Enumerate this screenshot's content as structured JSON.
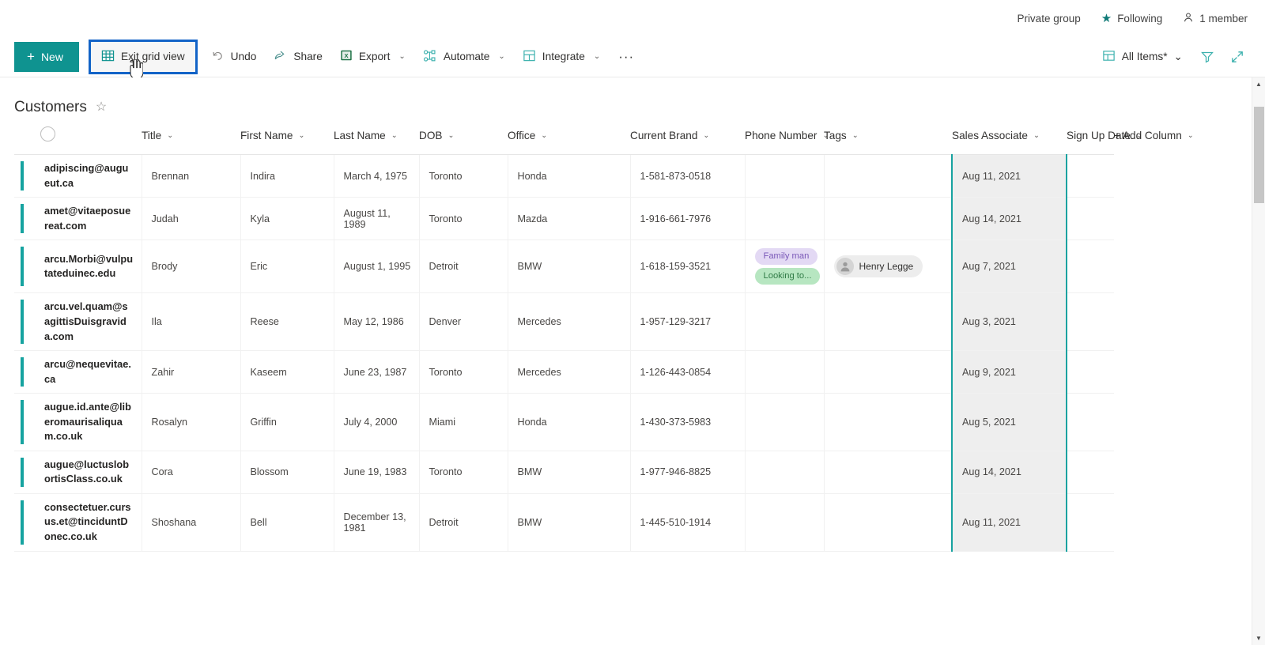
{
  "sitebar": {
    "privacy_label": "Private group",
    "following_label": "Following",
    "members_label": "1 member",
    "star_glyph": "★",
    "person_glyph": "⚲"
  },
  "commandbar": {
    "new_label": "New",
    "new_plus": "+",
    "exit_grid_view_label": "Exit grid view",
    "undo_label": "Undo",
    "share_label": "Share",
    "export_label": "Export",
    "automate_label": "Automate",
    "integrate_label": "Integrate",
    "overflow_label": "···",
    "chevron": "⌄",
    "view_label": "All Items*",
    "accent_color": "#0f9390",
    "highlight_color": "#1263c7"
  },
  "list": {
    "title": "Customers",
    "star_glyph": "☆",
    "selected_column": "Sign Up Date",
    "columns": [
      {
        "label": "Title"
      },
      {
        "label": "First Name"
      },
      {
        "label": "Last Name"
      },
      {
        "label": "DOB"
      },
      {
        "label": "Office"
      },
      {
        "label": "Current Brand"
      },
      {
        "label": "Phone Number"
      },
      {
        "label": "Tags"
      },
      {
        "label": "Sales Associate"
      },
      {
        "label": "Sign Up Date"
      },
      {
        "label": "+ Add Column"
      }
    ],
    "rows": [
      {
        "title": "adipiscing@augueut.ca",
        "first_name": "Brennan",
        "last_name": "Indira",
        "dob": "March 4, 1975",
        "office": "Toronto",
        "current_brand": "Honda",
        "phone_number": "1-581-873-0518",
        "tags": [],
        "sales_associate": "",
        "sign_up_date": "Aug 11, 2021"
      },
      {
        "title": "amet@vitaeposuereat.com",
        "first_name": "Judah",
        "last_name": "Kyla",
        "dob": "August 11, 1989",
        "office": "Toronto",
        "current_brand": "Mazda",
        "phone_number": "1-916-661-7976",
        "tags": [],
        "sales_associate": "",
        "sign_up_date": "Aug 14, 2021"
      },
      {
        "title": "arcu.Morbi@vulputateduinec.edu",
        "first_name": "Brody",
        "last_name": "Eric",
        "dob": "August 1, 1995",
        "office": "Detroit",
        "current_brand": "BMW",
        "phone_number": "1-618-159-3521",
        "tags": [
          {
            "label": "Family man",
            "color": "purple"
          },
          {
            "label": "Looking to...",
            "color": "green"
          }
        ],
        "sales_associate": "Henry Legge",
        "sign_up_date": "Aug 7, 2021"
      },
      {
        "title": "arcu.vel.quam@sagittisDuisgravida.com",
        "first_name": "Ila",
        "last_name": "Reese",
        "dob": "May 12, 1986",
        "office": "Denver",
        "current_brand": "Mercedes",
        "phone_number": "1-957-129-3217",
        "tags": [],
        "sales_associate": "",
        "sign_up_date": "Aug 3, 2021"
      },
      {
        "title": "arcu@nequevitae.ca",
        "first_name": "Zahir",
        "last_name": "Kaseem",
        "dob": "June 23, 1987",
        "office": "Toronto",
        "current_brand": "Mercedes",
        "phone_number": "1-126-443-0854",
        "tags": [],
        "sales_associate": "",
        "sign_up_date": "Aug 9, 2021"
      },
      {
        "title": "augue.id.ante@liberomaurisaliquam.co.uk",
        "first_name": "Rosalyn",
        "last_name": "Griffin",
        "dob": "July 4, 2000",
        "office": "Miami",
        "current_brand": "Honda",
        "phone_number": "1-430-373-5983",
        "tags": [],
        "sales_associate": "",
        "sign_up_date": "Aug 5, 2021"
      },
      {
        "title": "augue@luctuslobortisClass.co.uk",
        "first_name": "Cora",
        "last_name": "Blossom",
        "dob": "June 19, 1983",
        "office": "Toronto",
        "current_brand": "BMW",
        "phone_number": "1-977-946-8825",
        "tags": [],
        "sales_associate": "",
        "sign_up_date": "Aug 14, 2021"
      },
      {
        "title": "consectetuer.cursus.et@tinciduntDonec.co.uk",
        "first_name": "Shoshana",
        "last_name": "Bell",
        "dob": "December 13, 1981",
        "office": "Detroit",
        "current_brand": "BMW",
        "phone_number": "1-445-510-1914",
        "tags": [],
        "sales_associate": "",
        "sign_up_date": "Aug 11, 2021"
      }
    ]
  },
  "scrollbar": {
    "up_glyph": "▲",
    "down_glyph": "▼"
  }
}
